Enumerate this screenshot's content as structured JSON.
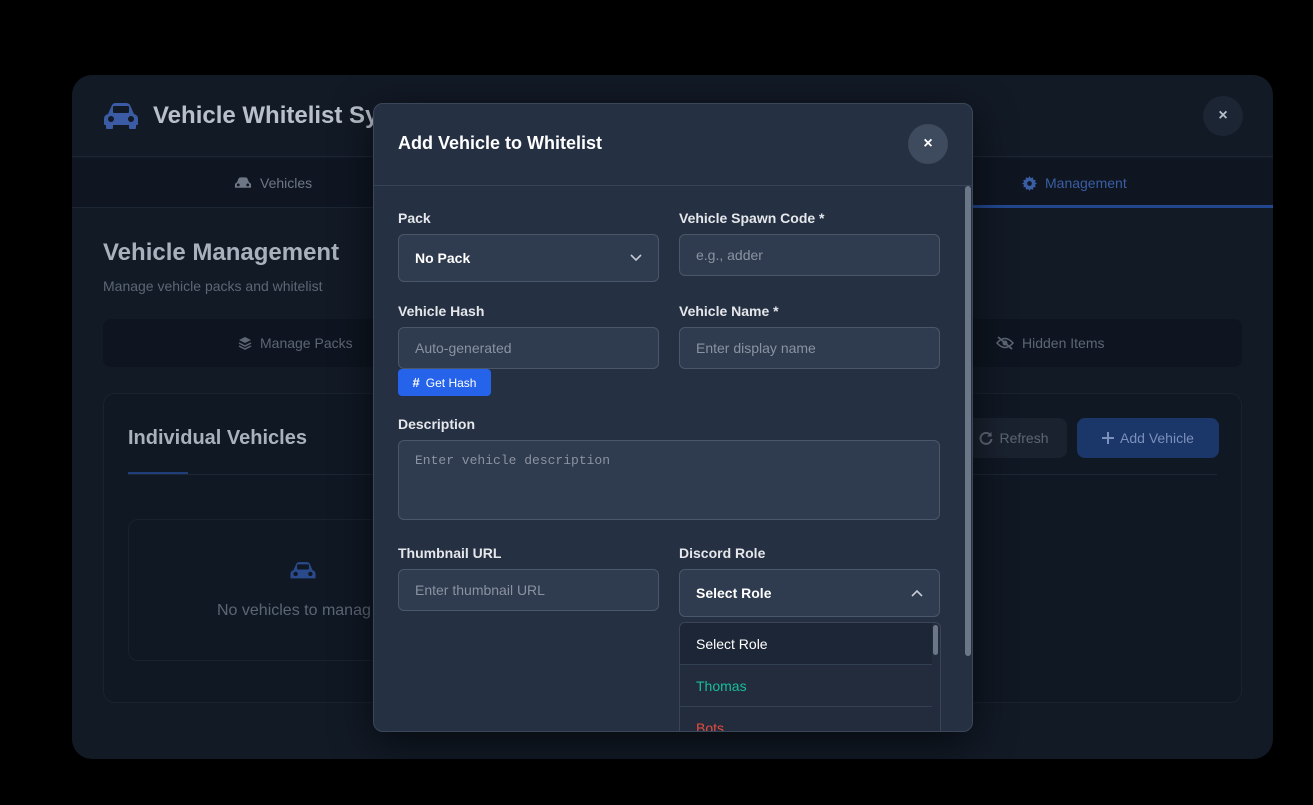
{
  "app": {
    "title": "Vehicle Whitelist Sy",
    "close_label": "×",
    "tabs": [
      {
        "label": "Vehicles"
      },
      {
        "label": "Management"
      }
    ],
    "management": {
      "title": "Vehicle Management",
      "subtitle": "Manage vehicle packs and whitelist",
      "subtabs": [
        {
          "label": "Manage Packs"
        },
        {
          "label": "Hidden Items"
        }
      ],
      "panel_title": "Individual Vehicles",
      "refresh_label": "Refresh",
      "add_vehicle_label": "Add Vehicle",
      "empty_text": "No vehicles to manag"
    }
  },
  "modal": {
    "title": "Add Vehicle to Whitelist",
    "close_label": "×",
    "fields": {
      "pack": {
        "label": "Pack",
        "value": "No Pack"
      },
      "spawn_code": {
        "label": "Vehicle Spawn Code *",
        "placeholder": "e.g., adder"
      },
      "hash": {
        "label": "Vehicle Hash",
        "placeholder": "Auto-generated"
      },
      "get_hash_label": "Get Hash",
      "name": {
        "label": "Vehicle Name *",
        "placeholder": "Enter display name"
      },
      "description": {
        "label": "Description",
        "placeholder": "Enter vehicle description"
      },
      "thumbnail": {
        "label": "Thumbnail URL",
        "placeholder": "Enter thumbnail URL"
      },
      "discord_role": {
        "label": "Discord Role",
        "value": "Select Role"
      }
    },
    "role_options": [
      {
        "label": "Select Role",
        "color": "#ffffff"
      },
      {
        "label": "Thomas",
        "color": "#1abc9c"
      },
      {
        "label": "Bots",
        "color": "#e74c3c"
      }
    ]
  },
  "colors": {
    "accent": "#2563eb",
    "modal_bg": "#253042",
    "app_bg": "#121a26"
  }
}
